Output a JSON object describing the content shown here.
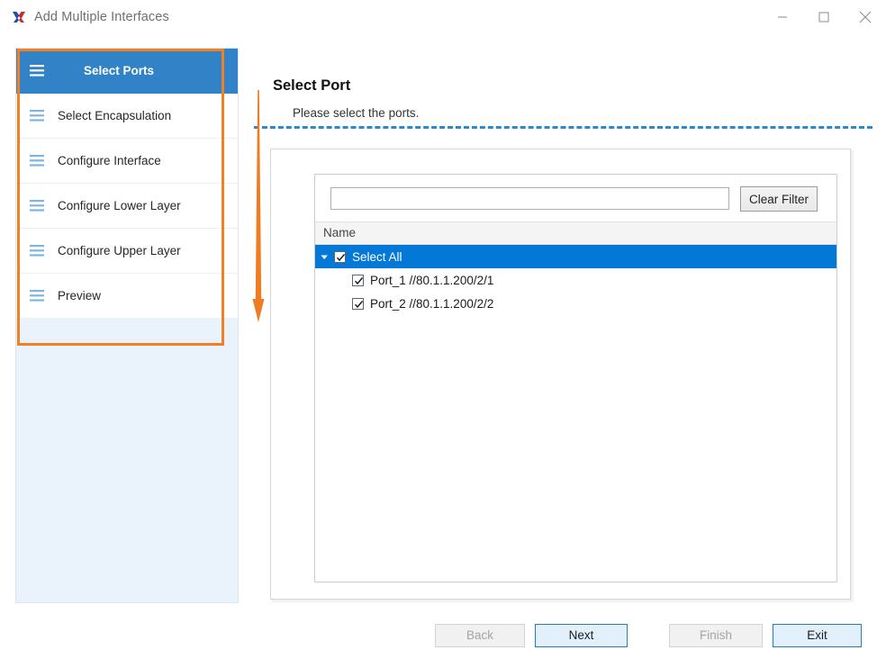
{
  "window": {
    "title": "Add Multiple Interfaces",
    "icon": "app-x-icon",
    "controls": {
      "minimize": "minimize-icon",
      "maximize": "maximize-icon",
      "close": "close-icon"
    }
  },
  "sidebar": {
    "items": [
      {
        "label": "Select Ports",
        "icon": "hamburger-icon",
        "active": true
      },
      {
        "label": "Select Encapsulation",
        "icon": "hamburger-icon",
        "active": false
      },
      {
        "label": "Configure Interface",
        "icon": "hamburger-icon",
        "active": false
      },
      {
        "label": "Configure Lower Layer",
        "icon": "hamburger-icon",
        "active": false
      },
      {
        "label": "Configure Upper Layer",
        "icon": "hamburger-icon",
        "active": false
      },
      {
        "label": "Preview",
        "icon": "hamburger-icon",
        "active": false
      }
    ]
  },
  "annotations": {
    "highlight_color": "#ef8023",
    "arrow": "down-arrow-annotation"
  },
  "main": {
    "heading": "Select Port",
    "subheading": "Please select the ports.",
    "separator_color": "#2f88c8",
    "filter": {
      "value": "",
      "placeholder": "",
      "clear_label": "Clear Filter"
    },
    "grid": {
      "column_header": "Name",
      "rows": [
        {
          "label": "Select All",
          "checked": true,
          "selected": true,
          "level": 0,
          "expanded": true
        },
        {
          "label": "Port_1 //80.1.1.200/2/1",
          "checked": true,
          "selected": false,
          "level": 1,
          "expanded": false
        },
        {
          "label": "Port_2 //80.1.1.200/2/2",
          "checked": true,
          "selected": false,
          "level": 1,
          "expanded": false
        }
      ]
    }
  },
  "footer": {
    "back": {
      "label": "Back",
      "enabled": false
    },
    "next": {
      "label": "Next",
      "enabled": true
    },
    "finish": {
      "label": "Finish",
      "enabled": false
    },
    "exit": {
      "label": "Exit",
      "enabled": true
    }
  }
}
